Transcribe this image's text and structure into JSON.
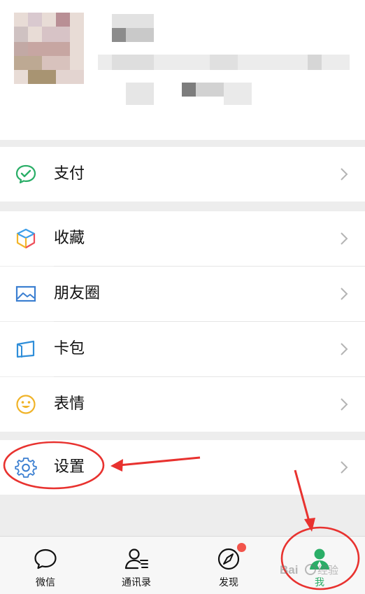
{
  "menu": {
    "pay": {
      "label": "支付",
      "icon": "wechat-pay-icon"
    },
    "favorites": {
      "label": "收藏",
      "icon": "favorites-cube-icon"
    },
    "moments": {
      "label": "朋友圈",
      "icon": "moments-album-icon"
    },
    "card_pack": {
      "label": "卡包",
      "icon": "card-wallet-icon"
    },
    "stickers": {
      "label": "表情",
      "icon": "smiley-icon"
    },
    "settings": {
      "label": "设置",
      "icon": "gear-icon"
    }
  },
  "bottom_nav": {
    "items": [
      {
        "label": "微信",
        "icon": "chat-bubble-icon",
        "active": false
      },
      {
        "label": "通讯录",
        "icon": "contacts-icon",
        "active": false
      },
      {
        "label": "发现",
        "icon": "compass-icon",
        "active": false,
        "badge": true
      },
      {
        "label": "我",
        "icon": "person-icon",
        "active": true
      }
    ]
  },
  "colors": {
    "accent_green": "#2aae67",
    "annotation_red": "#e8322f",
    "badge_red": "#f2544b"
  }
}
